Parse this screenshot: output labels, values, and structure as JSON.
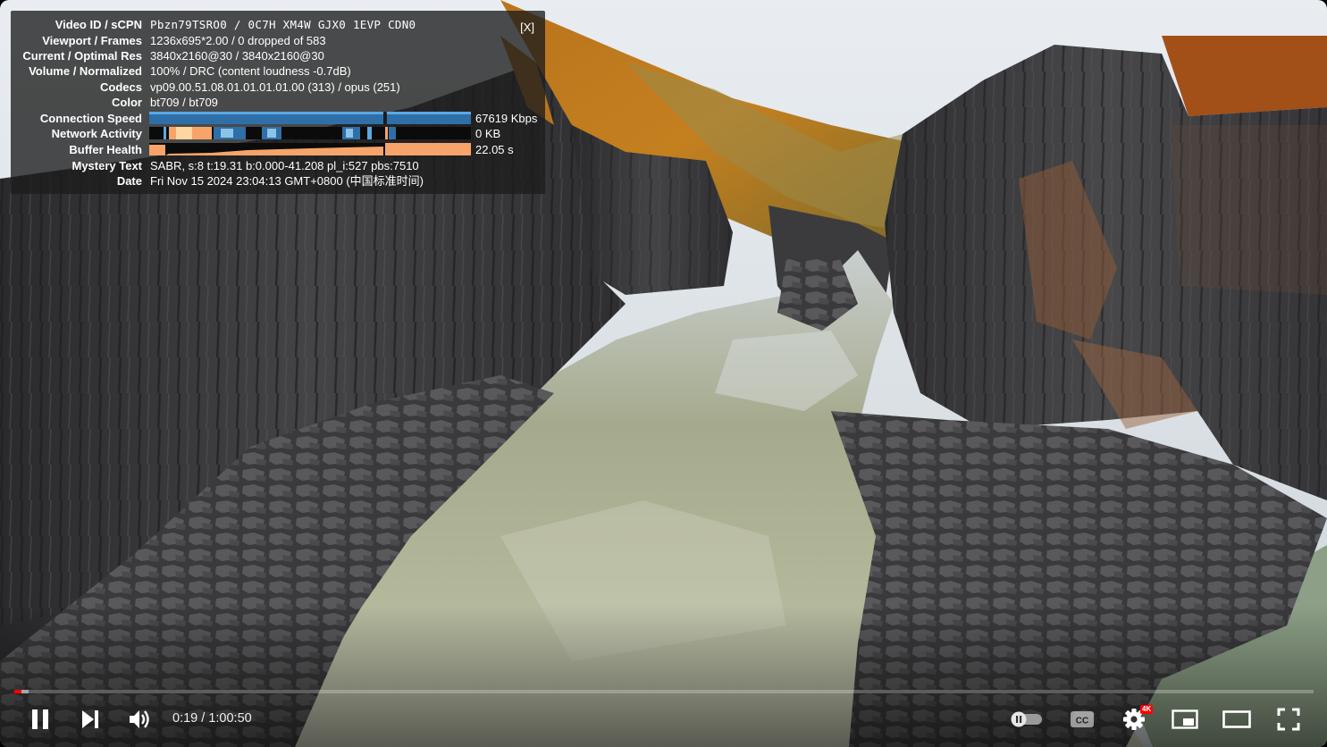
{
  "stats": {
    "close_label": "[X]",
    "rows": [
      {
        "label": "Video ID / sCPN",
        "value": "Pbzn79TSRO0 / 0C7H XM4W GJX0 1EVP CDN0"
      },
      {
        "label": "Viewport / Frames",
        "value": "1236x695*2.00 / 0 dropped of 583"
      },
      {
        "label": "Current / Optimal Res",
        "value": "3840x2160@30 / 3840x2160@30"
      },
      {
        "label": "Volume / Normalized",
        "value": "100% / DRC (content loudness -0.7dB)"
      },
      {
        "label": "Codecs",
        "value": "vp09.00.51.08.01.01.01.01.00 (313) / opus (251)"
      },
      {
        "label": "Color",
        "value": "bt709 / bt709"
      },
      {
        "label": "Connection Speed",
        "value": "67619 Kbps"
      },
      {
        "label": "Network Activity",
        "value": "0 KB"
      },
      {
        "label": "Buffer Health",
        "value": "22.05 s"
      },
      {
        "label": "Mystery Text",
        "value": "SABR, s:8 t:19.31 b:0.000-41.208 pl_i:527 pbs:7510"
      },
      {
        "label": "Date",
        "value": "Fri Nov 15 2024 23:04:13 GMT+0800 (中国标准时间)"
      }
    ]
  },
  "player": {
    "current_time": "0:19",
    "separator": " / ",
    "duration": "1:00:50",
    "played_fraction": 0.0053,
    "loaded_fraction": 0.0113,
    "quality_badge": "4K"
  },
  "icons": {
    "play_pause": "pause-icon",
    "next": "next-icon",
    "volume": "volume-icon",
    "autoplay": "autoplay-toggle-icon",
    "captions": "captions-icon",
    "settings": "gear-icon",
    "miniplayer": "miniplayer-icon",
    "theater": "theater-mode-icon",
    "fullscreen": "fullscreen-icon"
  },
  "colors": {
    "progress_played": "#ff0000",
    "connection_graph": "#3b8fd6",
    "buffer_graph": "#f6a46a"
  }
}
